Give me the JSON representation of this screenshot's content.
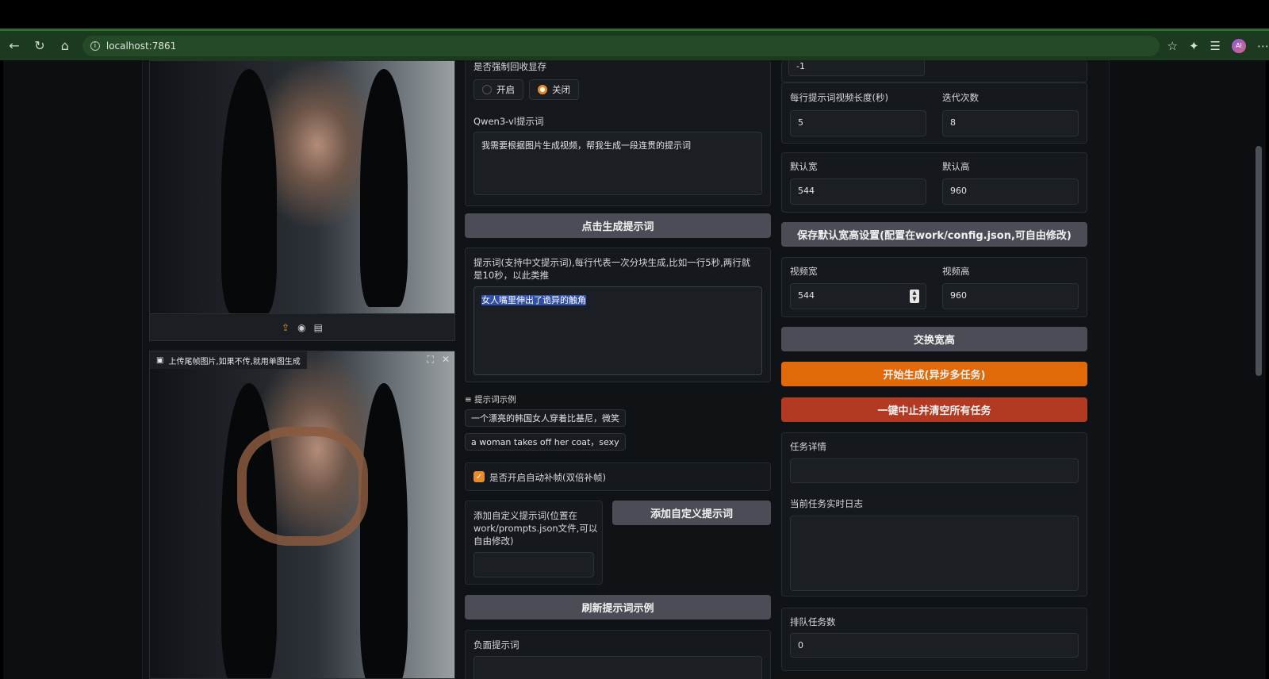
{
  "browser": {
    "url": "localhost:7861",
    "avatar_text": "AI"
  },
  "left": {
    "end_frame_label": "上传尾帧图片,如果不传,就用单图生成"
  },
  "middle": {
    "force_gc_label": "是否强制回收显存",
    "radio_on": "开启",
    "radio_off": "关闭",
    "qwen_label": "Qwen3-vl提示词",
    "qwen_value": "我需要根据图片生成视频，帮我生成一段连贯的提示词",
    "gen_prompt_button": "点击生成提示词",
    "prompt_label": "提示词(支持中文提示词),每行代表一次分块生成,比如一行5秒,两行就是10秒，以此类推",
    "prompt_value": "女人嘴里伸出了诡异的触角",
    "examples_label": "提示词示例",
    "example_1": "一个漂亮的韩国女人穿着比基尼，微笑",
    "example_2": "a woman takes off her coat，sexy",
    "interp_label": "是否开启自动补帧(双倍补帧)",
    "custom_prompt_label": "添加自定义提示词(位置在work/prompts.json文件,可以自由修改)",
    "add_custom_button": "添加自定义提示词",
    "refresh_button": "刷新提示词示例",
    "negative_label": "负面提示词"
  },
  "right": {
    "seed_value": "-1",
    "segment_len_label": "每行提示词视频长度(秒)",
    "segment_len_value": "5",
    "iterations_label": "迭代次数",
    "iterations_value": "8",
    "default_w_label": "默认宽",
    "default_w_value": "544",
    "default_h_label": "默认高",
    "default_h_value": "960",
    "save_default_button": "保存默认宽高设置(配置在work/config.json,可自由修改)",
    "video_w_label": "视频宽",
    "video_w_value": "544",
    "video_h_label": "视频高",
    "video_h_value": "960",
    "swap_button": "交换宽高",
    "start_button": "开始生成(异步多任务)",
    "stop_button": "一键中止并清空所有任务",
    "task_detail_label": "任务详情",
    "task_log_label": "当前任务实时日志",
    "queue_label": "排队任务数",
    "queue_value": "0"
  },
  "colors": {
    "accent_orange": "#e26908",
    "danger_red": "#b23a22",
    "button_gray": "#4a4d55",
    "browser_green": "#1c3a1f"
  }
}
